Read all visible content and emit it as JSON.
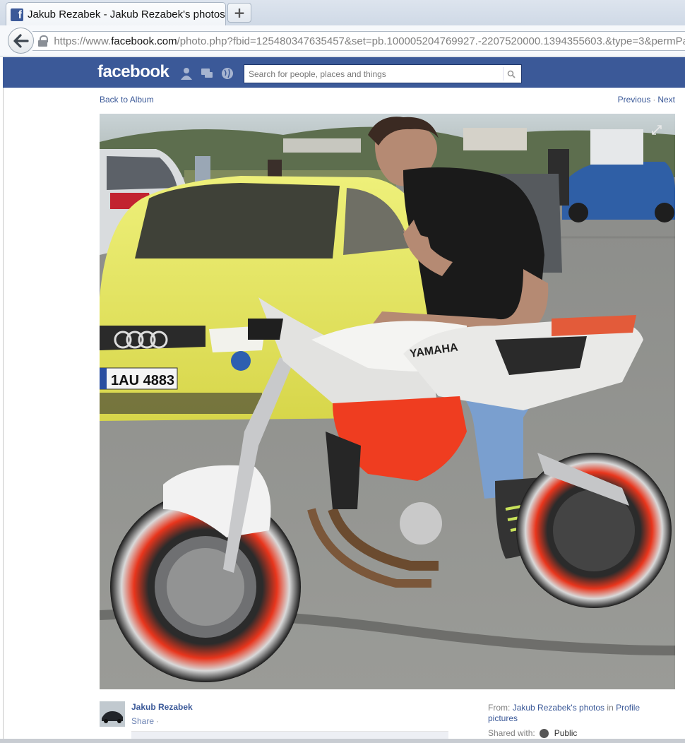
{
  "browser": {
    "tab_title": "Jakub Rezabek - Jakub Rezabek's photos",
    "favicon": "f",
    "new_tab_label": "+",
    "url_prefix": "https://www.",
    "url_domain": "facebook.com",
    "url_rest": "/photo.php?fbid=125480347635457&set=pb.100005204769927.-2207520000.1394355603.&type=3&permPa"
  },
  "header": {
    "logo": "facebook",
    "search_placeholder": "Search for people, places and things"
  },
  "photo_nav": {
    "back_to_album": "Back to Album",
    "previous": "Previous",
    "separator": "·",
    "next": "Next"
  },
  "photo": {
    "plate_text": "1AU 4883",
    "bike_brand_text": "YAMAHA"
  },
  "footer": {
    "owner_name": "Jakub Rezabek",
    "share": "Share",
    "share_dot": "·",
    "from_label": "From:",
    "from_album": "Jakub Rezabek's photos",
    "from_in": "in",
    "from_target": "Profile pictures",
    "shared_with_label": "Shared with:",
    "shared_with_value": "Public"
  },
  "colors": {
    "fb_blue": "#3b5998",
    "link": "#3b5998"
  }
}
